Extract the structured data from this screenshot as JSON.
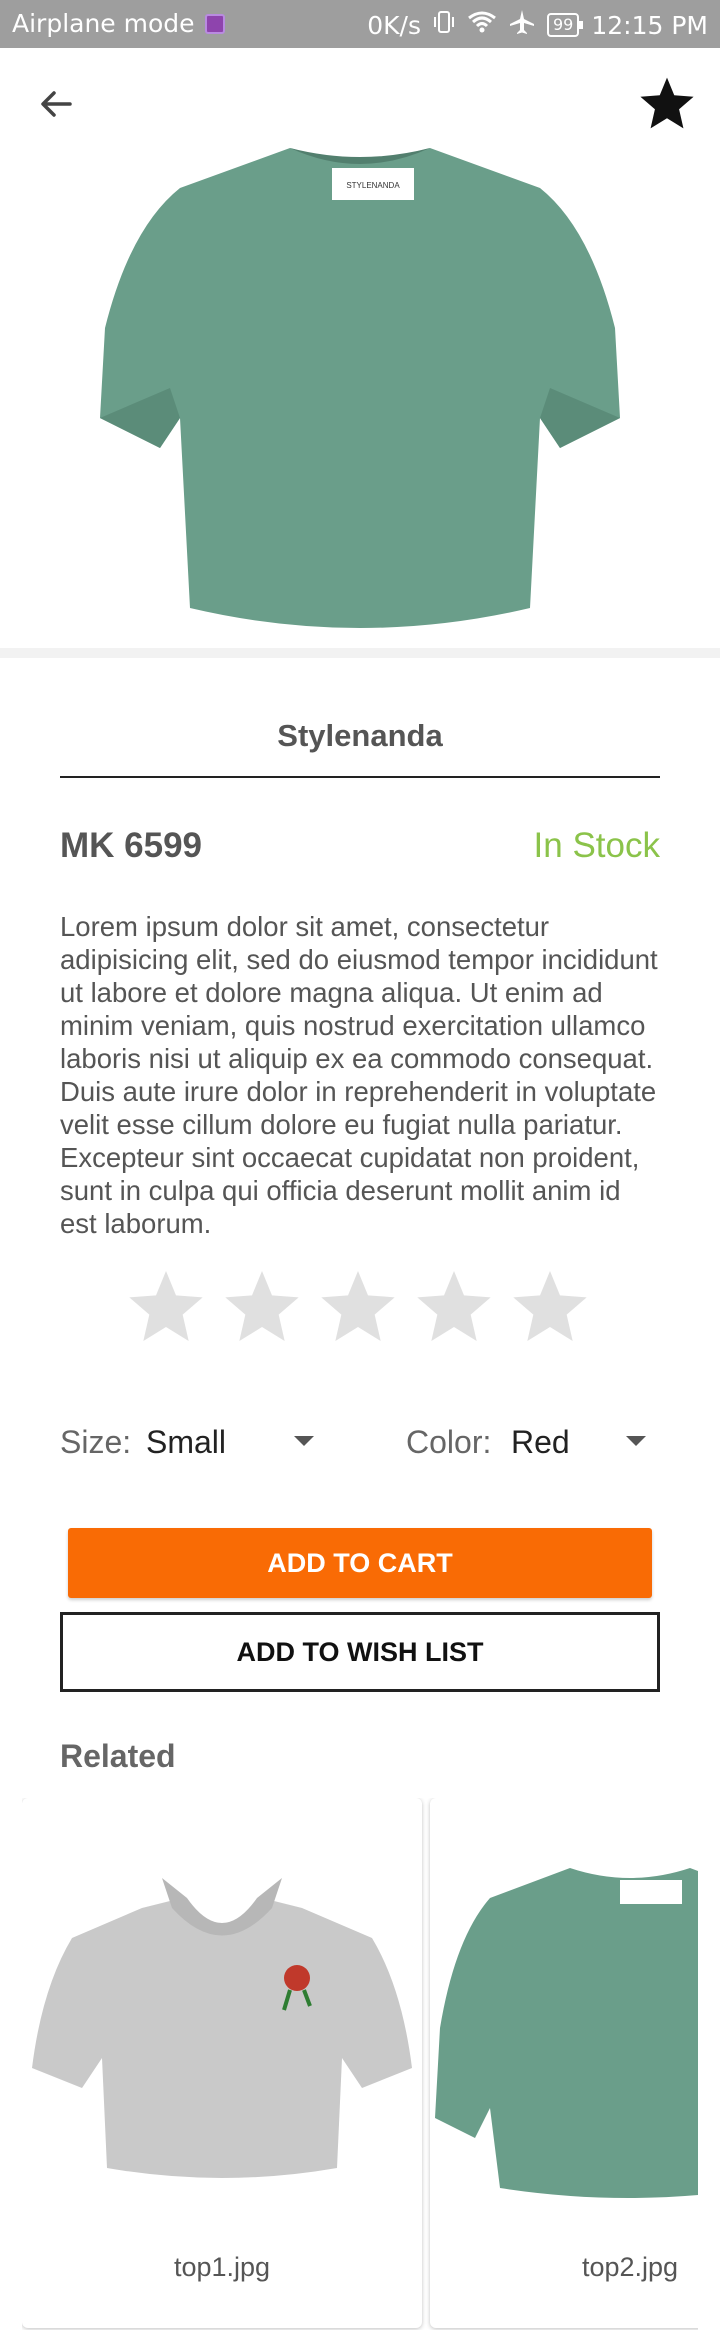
{
  "status_bar": {
    "mode": "Airplane mode",
    "speed": "0K/s",
    "battery": "99",
    "time": "12:15 PM"
  },
  "product": {
    "brand": "Stylenanda",
    "sku": "MK 6599",
    "stock_status": "In Stock",
    "description": "Lorem ipsum dolor sit amet, consectetur adipisicing elit, sed do eiusmod tempor incididunt ut labore et dolore magna aliqua. Ut enim ad minim veniam, quis nostrud exercitation ullamco laboris nisi ut aliquip ex ea commodo consequat. Duis aute irure dolor in reprehenderit in voluptate velit esse cillum dolore eu fugiat nulla pariatur. Excepteur sint occaecat cupidatat non proident, sunt in culpa qui officia deserunt mollit anim id est laborum.",
    "rating": 0,
    "rating_max": 5,
    "hero_label": "STYLENANDA"
  },
  "options": {
    "size_label": "Size:",
    "size_value": "Small",
    "color_label": "Color:",
    "color_value": "Red"
  },
  "actions": {
    "add_to_cart": "ADD TO CART",
    "add_to_wish_list": "ADD TO WISH LIST"
  },
  "related": {
    "title": "Related",
    "items": [
      {
        "caption": "top1.jpg"
      },
      {
        "caption": "top2.jpg"
      }
    ]
  },
  "colors": {
    "accent": "#f96b05",
    "in_stock": "#8bc34a",
    "status_bar": "#9e9e9e",
    "shirt_green": "#6a9e8a",
    "shirt_gray": "#c9c9c9",
    "star_empty": "#e0e0e0"
  },
  "icons": {
    "back": "arrow-left-icon",
    "favorite": "star-icon",
    "dropdown": "caret-down-icon"
  }
}
